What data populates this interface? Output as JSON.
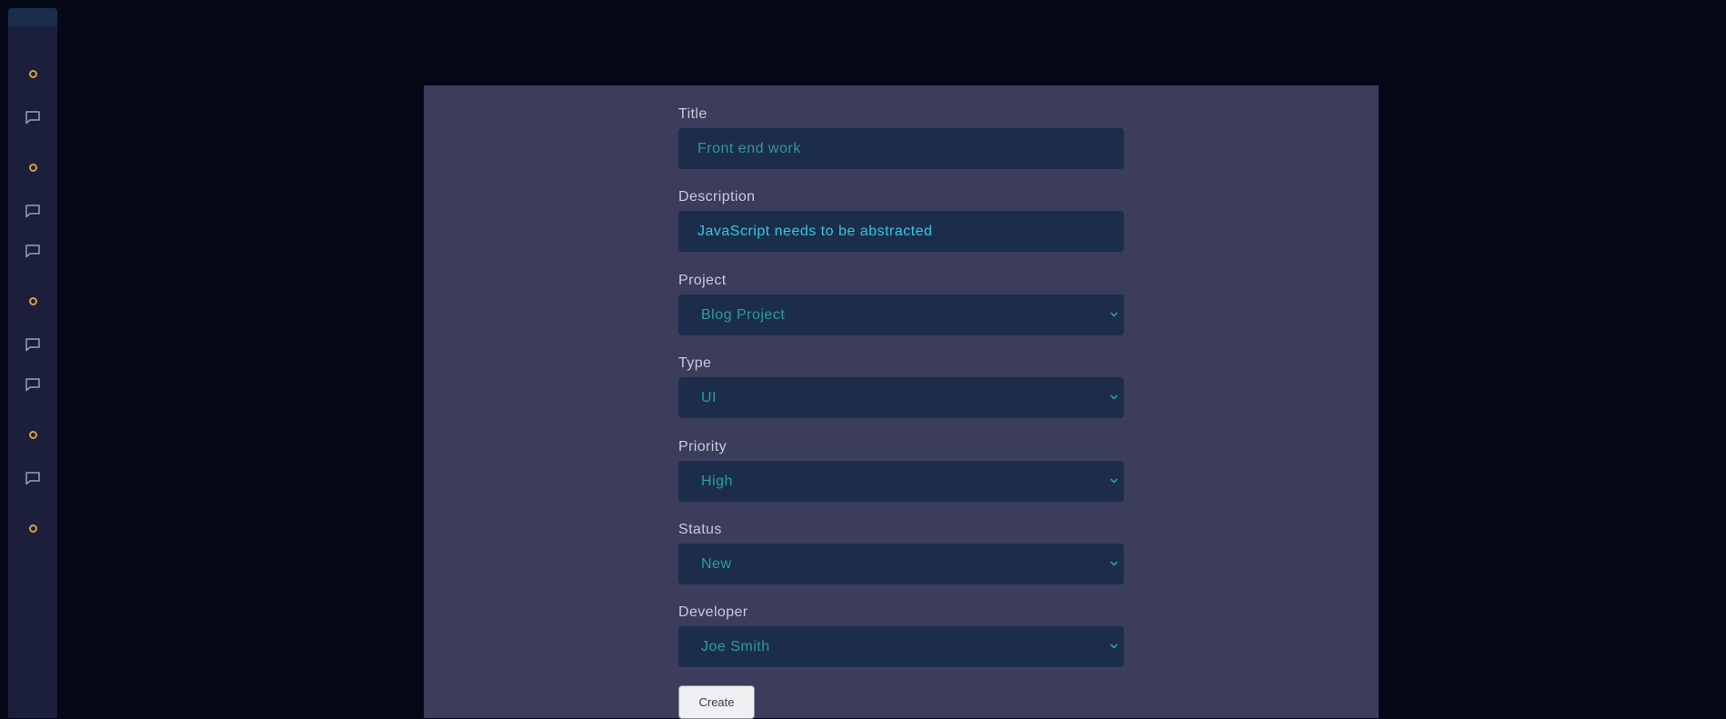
{
  "sidebar": {
    "icons": [
      "circle-icon",
      "chat-icon",
      "circle-icon",
      "chat-icon",
      "chat-icon",
      "circle-icon",
      "chat-icon",
      "chat-icon",
      "circle-icon",
      "chat-icon",
      "circle-icon"
    ]
  },
  "form": {
    "title": {
      "label": "Title",
      "value": "Front end work"
    },
    "description": {
      "label": "Description",
      "value": "JavaScript needs to be abstracted"
    },
    "project": {
      "label": "Project",
      "value": "Blog Project"
    },
    "type": {
      "label": "Type",
      "value": "UI"
    },
    "priority": {
      "label": "Priority",
      "value": "High"
    },
    "status": {
      "label": "Status",
      "value": "New"
    },
    "developer": {
      "label": "Developer",
      "value": "Joe Smith"
    },
    "create_label": "Create"
  },
  "colors": {
    "background": "#050816",
    "sidebar": "#1b1f3b",
    "panel": "#3b3d5b",
    "field": "#1c2d4b",
    "value_text": "#2a9e98",
    "active_text": "#35c7dd",
    "icon_accent": "#d4a04a"
  }
}
